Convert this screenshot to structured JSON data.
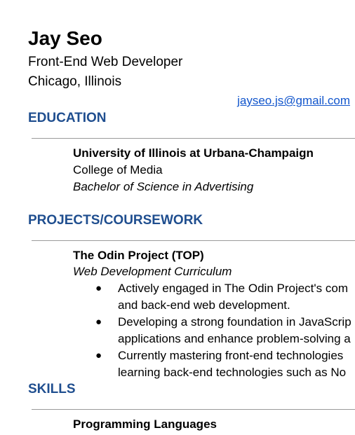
{
  "header": {
    "name": "Jay Seo",
    "role": "Front-End Web Developer",
    "location": "Chicago, Illinois",
    "email": "jayseo.js@gmail.com"
  },
  "education": {
    "heading": "EDUCATION",
    "school": "University of Illinois at Urbana-Champaign",
    "college": "College of Media",
    "degree": "Bachelor of Science in Advertising"
  },
  "projects": {
    "heading": "PROJECTS/COURSEWORK",
    "title": "The Odin Project (TOP)",
    "subtitle": "Web Development Curriculum",
    "bullets": [
      {
        "line1": "Actively engaged in The Odin Project's com",
        "line2": "and back-end web development."
      },
      {
        "line1": "Developing a strong foundation in JavaScrip",
        "line2": "applications and enhance problem-solving a"
      },
      {
        "line1": "Currently mastering front-end technologies",
        "line2": "learning back-end technologies such as No"
      }
    ]
  },
  "skills": {
    "heading": "SKILLS",
    "category": "Programming Languages"
  },
  "colors": {
    "heading": "#1f4e8f",
    "link": "#1155cc",
    "rule": "#9a9a9a"
  }
}
